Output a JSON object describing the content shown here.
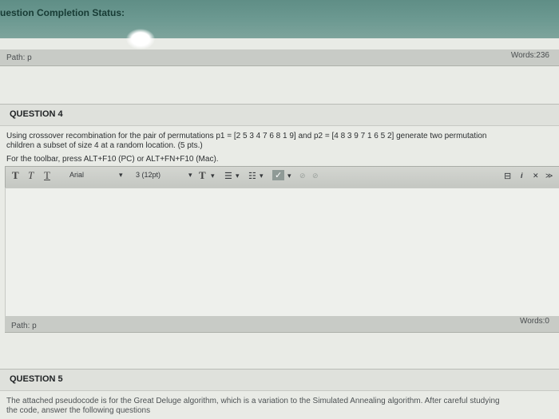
{
  "header": {
    "status_label": "uestion Completion Status:"
  },
  "editor1": {
    "path_label": "Path: p",
    "words_label": "Words:236"
  },
  "question4": {
    "title": "QUESTION 4",
    "line1": "Using crossover recombination for the pair of permutations p1 = [2 5 3 4 7 6 8 1 9] and p2 = [4 8 3 9 7 1 6 5 2] generate two permutation",
    "line2": "children a subset of size 4 at a random location. (5 pts.)",
    "toolbar_hint": "For the toolbar, press ALT+F10 (PC) or ALT+FN+F10 (Mac)."
  },
  "toolbar": {
    "bold": "T",
    "italic": "T",
    "underline": "T",
    "font_family": "Arial",
    "font_size": "3 (12pt)",
    "text_color": "T",
    "caret": "▾",
    "list_bullet": "☰",
    "list_number": "☷",
    "spellcheck": "✓",
    "link": "⊘",
    "unlink": "⊘",
    "right_preview": "⊟",
    "right_info": "i",
    "right_expand": "✕",
    "right_collapse": "≫"
  },
  "editor2": {
    "path_label": "Path: p",
    "words_label": "Words:0"
  },
  "question5": {
    "title": "QUESTION 5",
    "line1": "The attached pseudocode is for the Great Deluge algorithm, which is a variation to the Simulated Annealing algorithm. After careful studying",
    "line2": "the code, answer the following questions"
  },
  "colors": {
    "header_band": "#6d9a92",
    "panel_bg": "#e9ebe6",
    "toolbar_bg": "#c8cbc6"
  }
}
